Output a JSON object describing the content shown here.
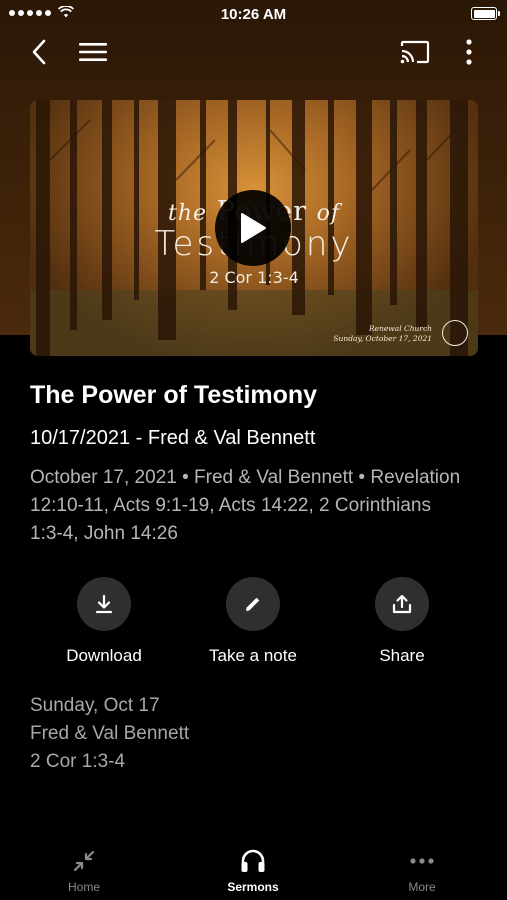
{
  "status_bar": {
    "time": "10:26 AM"
  },
  "artwork": {
    "title_word_1": "the",
    "title_word_2": "Power",
    "title_word_3": "of",
    "title_line_2": "Testimony",
    "reference": "2 Cor 1:3-4",
    "church_name": "Renewal Church",
    "church_date": "Sunday, October 17, 2021"
  },
  "sermon": {
    "title": "The Power of Testimony",
    "subtitle": "10/17/2021 - Fred & Val Bennett",
    "meta_line_1": "October 17, 2021 • Fred & Val Bennett • Revelation",
    "meta_line_2": "12:10-11, Acts 9:1-19, Acts 14:22, 2 Corinthians",
    "meta_line_3": "1:3-4, John 14:26"
  },
  "actions": {
    "download_label": "Download",
    "note_label": "Take a note",
    "share_label": "Share"
  },
  "details": {
    "date": "Sunday, Oct 17",
    "speaker": "Fred & Val Bennett",
    "reference": "2 Cor 1:3-4"
  },
  "tab_bar": {
    "items": [
      {
        "label": "Home",
        "icon": "collapse-arrows-icon",
        "active": false
      },
      {
        "label": "Sermons",
        "icon": "headphones-icon",
        "active": true
      },
      {
        "label": "More",
        "icon": "ellipsis-icon",
        "active": false
      }
    ]
  },
  "colors": {
    "header_brown": "#3a2009",
    "background": "#000000",
    "secondary_text": "#b5b5b5",
    "action_circle": "#2f2f2f",
    "tab_inactive": "#8a8a8a"
  }
}
